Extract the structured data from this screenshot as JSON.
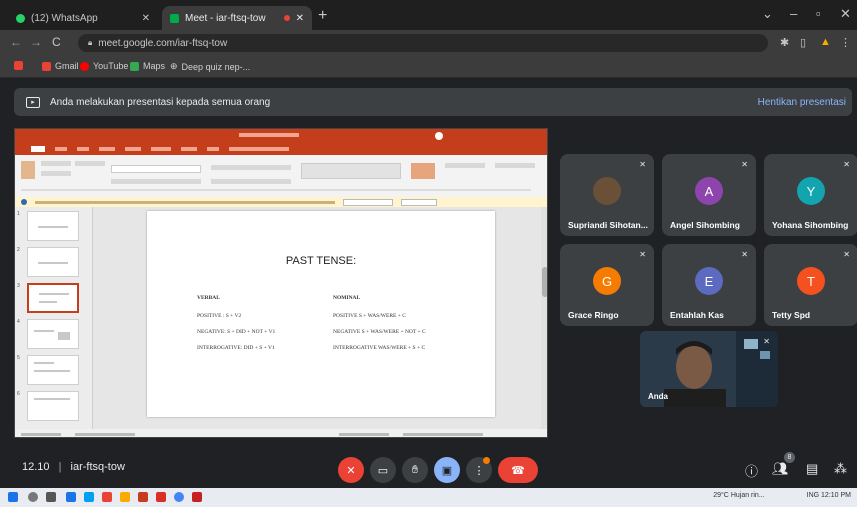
{
  "browser": {
    "tabs": [
      {
        "label": "(12) WhatsApp"
      },
      {
        "label": "Meet - iar-ftsq-tow"
      }
    ],
    "url": "meet.google.com/iar-ftsq-tow",
    "bookmarks": [
      {
        "label": "Gmail",
        "color": "#ea4335"
      },
      {
        "label": "YouTube",
        "color": "#ff0000"
      },
      {
        "label": "Maps",
        "color": "#34a853"
      },
      {
        "label": "Deep quiz nep-..."
      }
    ]
  },
  "banner": {
    "text": "Anda melakukan presentasi kepada semua orang",
    "stop_label": "Hentikan presentasi"
  },
  "slide": {
    "title": "PAST TENSE:",
    "verbal_heading": "VERBAL",
    "nominal_heading": "NOMINAL",
    "verbal_lines": [
      "POSITIVE : S + V2",
      "NEGATIVE: S + DID + NOT + V1",
      "INTERROGATIVE: DID + S + V1"
    ],
    "nominal_lines": [
      "POSITIVE        S + WAS/WERE + C",
      "NEGATIVE        S + WAS/WERE + NOT + C",
      "INTERROGATIVE  WAS/WERE + S + C"
    ]
  },
  "participants": [
    {
      "name": "Supriandi Sihotan...",
      "initial": "",
      "color": "#5a4a3a"
    },
    {
      "name": "Angel Sihombing",
      "initial": "A",
      "color": "#8e44ad"
    },
    {
      "name": "Yohana Sihombing",
      "initial": "Y",
      "color": "#12a4af"
    },
    {
      "name": "Grace Ringo",
      "initial": "G",
      "color": "#f57c00"
    },
    {
      "name": "Entahlah Kas",
      "initial": "E",
      "color": "#5c6bc0"
    },
    {
      "name": "Tetty Spd",
      "initial": "T",
      "color": "#f4511e"
    }
  ],
  "self": {
    "name": "Anda"
  },
  "meeting": {
    "time": "12.10",
    "code": "iar-ftsq-tow"
  },
  "participant_count": "8",
  "tray": {
    "temp": "29°C",
    "weather": "Hujan rin...",
    "lang": "ING",
    "time": "12:10 PM"
  }
}
